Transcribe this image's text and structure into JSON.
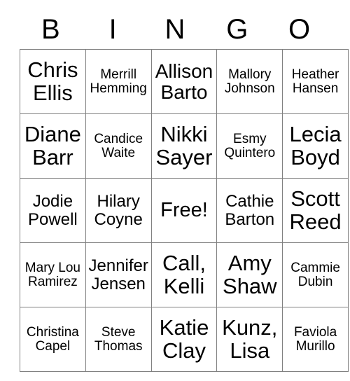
{
  "card": {
    "headers": [
      "B",
      "I",
      "N",
      "G",
      "O"
    ],
    "rows": [
      [
        {
          "text": "Chris Ellis",
          "size": "sz-xl",
          "free": false
        },
        {
          "text": "Merrill Hemming",
          "size": "sz-sm",
          "free": false
        },
        {
          "text": "Allison Barto",
          "size": "sz-lg",
          "free": false
        },
        {
          "text": "Mallory Johnson",
          "size": "sz-sm",
          "free": false
        },
        {
          "text": "Heather Hansen",
          "size": "sz-sm",
          "free": false
        }
      ],
      [
        {
          "text": "Diane Barr",
          "size": "sz-xl",
          "free": false
        },
        {
          "text": "Candice Waite",
          "size": "sz-sm",
          "free": false
        },
        {
          "text": "Nikki Sayer",
          "size": "sz-xl",
          "free": false
        },
        {
          "text": "Esmy Quintero",
          "size": "sz-sm",
          "free": false
        },
        {
          "text": "Lecia Boyd",
          "size": "sz-xl",
          "free": false
        }
      ],
      [
        {
          "text": "Jodie Powell",
          "size": "sz-md",
          "free": false
        },
        {
          "text": "Hilary Coyne",
          "size": "sz-md",
          "free": false
        },
        {
          "text": "Free!",
          "size": "free",
          "free": true
        },
        {
          "text": "Cathie Barton",
          "size": "sz-md",
          "free": false
        },
        {
          "text": "Scott Reed",
          "size": "sz-xl",
          "free": false
        }
      ],
      [
        {
          "text": "Mary Lou Ramirez",
          "size": "sz-sm",
          "free": false
        },
        {
          "text": "Jennifer Jensen",
          "size": "sz-md",
          "free": false
        },
        {
          "text": "Call, Kelli",
          "size": "sz-xl",
          "free": false
        },
        {
          "text": "Amy Shaw",
          "size": "sz-xl",
          "free": false
        },
        {
          "text": "Cammie Dubin",
          "size": "sz-sm",
          "free": false
        }
      ],
      [
        {
          "text": "Christina Capel",
          "size": "sz-sm",
          "free": false
        },
        {
          "text": "Steve Thomas",
          "size": "sz-sm",
          "free": false
        },
        {
          "text": "Katie Clay",
          "size": "sz-xl",
          "free": false
        },
        {
          "text": "Kunz, Lisa",
          "size": "sz-xl",
          "free": false
        },
        {
          "text": "Faviola Murillo",
          "size": "sz-sm",
          "free": false
        }
      ]
    ]
  }
}
